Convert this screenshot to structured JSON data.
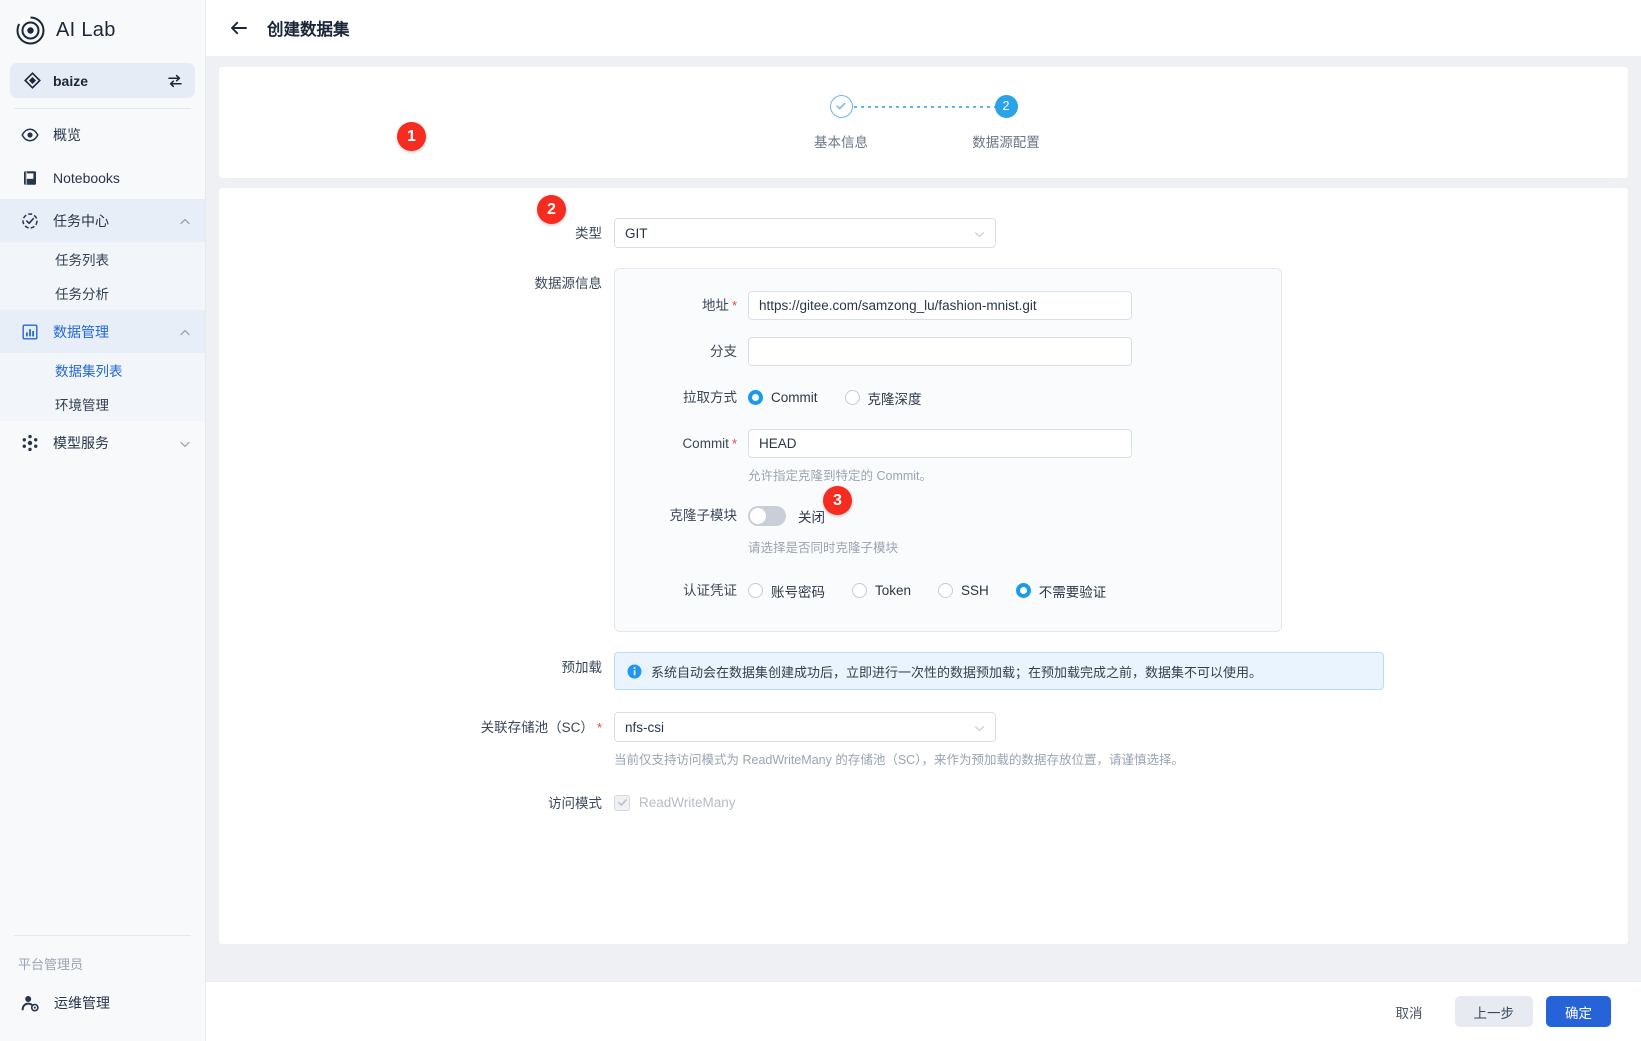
{
  "sidebar": {
    "brand": "AI Lab",
    "project": {
      "name": "baize",
      "switch_icon": "switch-icon",
      "icon": "project-icon"
    },
    "items": [
      {
        "label": "概览",
        "icon": "eye-icon"
      },
      {
        "label": "Notebooks",
        "icon": "notebook-icon"
      }
    ],
    "groups": [
      {
        "label": "任务中心",
        "icon": "task-center-icon",
        "chevron": "chevron-up-icon",
        "children": [
          {
            "label": "任务列表"
          },
          {
            "label": "任务分析"
          }
        ]
      },
      {
        "label": "数据管理",
        "icon": "data-management-icon",
        "chevron": "chevron-up-icon",
        "children": [
          {
            "label": "数据集列表"
          },
          {
            "label": "环境管理"
          }
        ]
      },
      {
        "label": "模型服务",
        "icon": "model-service-icon",
        "chevron": "chevron-down-icon",
        "children": []
      }
    ],
    "role_title": "平台管理员",
    "ops": {
      "label": "运维管理",
      "icon": "ops-user-icon"
    }
  },
  "topbar": {
    "back_icon": "back-arrow-icon",
    "title": "创建数据集"
  },
  "steps": [
    {
      "number": "1",
      "label": "基本信息",
      "state": "done"
    },
    {
      "number": "2",
      "label": "数据源配置",
      "state": "current"
    }
  ],
  "form": {
    "type": {
      "label": "类型",
      "value": "GIT",
      "chevron": "chevron-down-icon"
    },
    "source": {
      "label": "数据源信息",
      "address": {
        "label": "地址",
        "required": "*",
        "value": "https://gitee.com/samzong_lu/fashion-mnist.git"
      },
      "branch": {
        "label": "分支",
        "value": ""
      },
      "pull_mode": {
        "label": "拉取方式",
        "options": [
          {
            "label": "Commit",
            "selected": true
          },
          {
            "label": "克隆深度",
            "selected": false
          }
        ]
      },
      "commit": {
        "label": "Commit",
        "required": "*",
        "value": "HEAD",
        "hint": "允许指定克隆到特定的 Commit。"
      },
      "submodule": {
        "label": "克隆子模块",
        "state_label": "关闭",
        "enabled": false,
        "hint": "请选择是否同时克隆子模块"
      },
      "auth": {
        "label": "认证凭证",
        "options": [
          {
            "label": "账号密码",
            "selected": false
          },
          {
            "label": "Token",
            "selected": false
          },
          {
            "label": "SSH",
            "selected": false
          },
          {
            "label": "不需要验证",
            "selected": true
          }
        ]
      }
    },
    "preload": {
      "label": "预加载",
      "icon": "info-icon",
      "message": "系统自动会在数据集创建成功后，立即进行一次性的数据预加载；在预加载完成之前，数据集不可以使用。"
    },
    "storage": {
      "label": "关联存储池（SC）",
      "required": "*",
      "value": "nfs-csi",
      "chevron": "chevron-down-icon",
      "hint": "当前仅支持访问模式为 ReadWriteMany 的存储池（SC），来作为预加载的数据存放位置，请谨慎选择。"
    },
    "access_mode": {
      "label": "访问模式",
      "value": "ReadWriteMany",
      "checked": true,
      "disabled": true
    }
  },
  "footer": {
    "cancel": "取消",
    "previous": "上一步",
    "confirm": "确定"
  },
  "annotations": [
    {
      "number": "1"
    },
    {
      "number": "2"
    },
    {
      "number": "3"
    }
  ],
  "colors": {
    "primary": "#2763d8",
    "step_active": "#2aa3e8",
    "badge_red": "#f52c1f",
    "link_blue": "#2468d6",
    "required_red": "#e34935"
  }
}
